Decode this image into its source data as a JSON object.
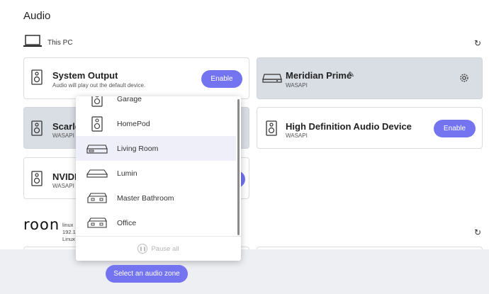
{
  "page": {
    "title": "Audio"
  },
  "section_pc": {
    "label": "This PC",
    "refresh_icon": "refresh-icon"
  },
  "devices": [
    {
      "name": "System Output",
      "sub": "Audio will play out the default device.",
      "action": "Enable",
      "icon": "speaker-icon"
    },
    {
      "name": "Meridian Prime",
      "sub": "WASAPI",
      "icon": "amplifier-icon",
      "edit_icon": "pencil-icon",
      "settings_icon": "gear-icon"
    },
    {
      "name": "Scarlett",
      "sub": "WASAPI",
      "icon": "speaker-icon"
    },
    {
      "name": "High Definition Audio Device",
      "sub": "WASAPI",
      "action": "Enable",
      "icon": "speaker-icon"
    },
    {
      "name": "NVIDI",
      "sub": "WASAPI",
      "icon": "speaker-icon"
    }
  ],
  "roon_section": {
    "logo_text": "roon",
    "meta": [
      "linux",
      "192.1",
      "Linux"
    ],
    "refresh_icon": "refresh-icon"
  },
  "zone_dropdown": {
    "items": [
      {
        "label": "Garage",
        "icon": "speaker-icon"
      },
      {
        "label": "HomePod",
        "icon": "speaker-icon"
      },
      {
        "label": "Living Room",
        "icon": "streamer-icon"
      },
      {
        "label": "Lumin",
        "icon": "streamer-icon"
      },
      {
        "label": "Master Bathroom",
        "icon": "amplifier-icon"
      },
      {
        "label": "Office",
        "icon": "amplifier-icon"
      }
    ],
    "selected": "Living Room",
    "pause_all": "Pause all"
  },
  "footer": {
    "select_zone": "Select an audio zone"
  },
  "colors": {
    "accent": "#7474f0",
    "card_selected": "#d9dde4"
  }
}
